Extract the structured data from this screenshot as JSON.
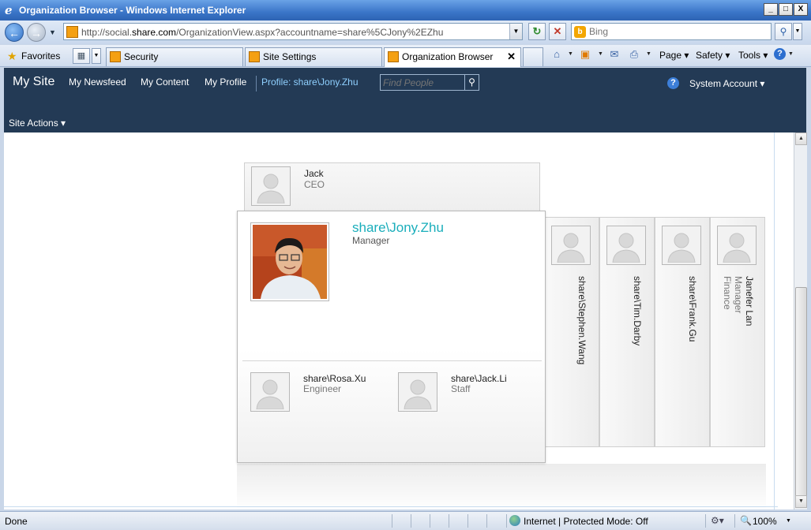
{
  "window": {
    "title": "Organization Browser - Windows Internet Explorer",
    "buttons": [
      "_",
      "□",
      "X"
    ]
  },
  "address": {
    "url_prefix": "http://social.",
    "url_domain": "share.com",
    "url_suffix": "/OrganizationView.aspx?accountname=share%5CJony%2EZhu"
  },
  "search": {
    "placeholder": "Bing"
  },
  "favorites": {
    "label": "Favorites"
  },
  "tabs": [
    {
      "label": "Security"
    },
    {
      "label": "Site Settings"
    },
    {
      "label": "Organization Browser"
    }
  ],
  "commands": {
    "page": "Page",
    "safety": "Safety",
    "tools": "Tools"
  },
  "sharepoint": {
    "mysite": "My Site",
    "nav": [
      "My Newsfeed",
      "My Content",
      "My Profile"
    ],
    "profile_link": "Profile: share\\Jony.Zhu",
    "find_placeholder": "Find People",
    "account": "System Account",
    "site_actions": "Site Actions"
  },
  "org": {
    "ceo": {
      "name": "Jack",
      "title": "CEO"
    },
    "current": {
      "name": "share\\Jony.Zhu",
      "title": "Manager"
    },
    "reports": [
      {
        "name": "share\\Rosa.Xu",
        "title": "Engineer"
      },
      {
        "name": "share\\Jack.Li",
        "title": "Staff"
      }
    ],
    "peers": [
      {
        "name": "share\\Stephen.Wang",
        "line2": "",
        "line3": ""
      },
      {
        "name": "share\\Tim.Darby",
        "line2": "",
        "line3": ""
      },
      {
        "name": "share\\Frank.Gu",
        "line2": "",
        "line3": ""
      },
      {
        "name": "Janefer Lan",
        "line2": "Manager",
        "line3": "Finance"
      }
    ]
  },
  "status": {
    "text": "Done",
    "zone": "Internet | Protected Mode: Off",
    "zoom": "100%"
  }
}
